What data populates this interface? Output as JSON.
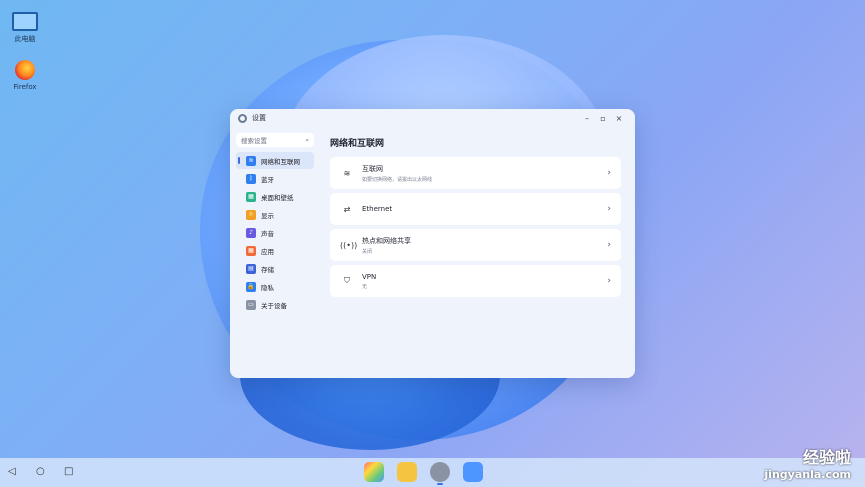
{
  "desktop": {
    "icons": [
      {
        "label": "此电脑",
        "icon": "monitor-icon"
      },
      {
        "label": "Firefox",
        "icon": "firefox-icon"
      }
    ]
  },
  "window": {
    "title": "设置",
    "controls": {
      "minimize": "–",
      "maximize": "▫",
      "close": "×"
    }
  },
  "sidebar": {
    "search_placeholder": "搜索设置",
    "search_icon": "⌕",
    "items": [
      {
        "label": "网络和互联网",
        "icon": "wifi-icon",
        "color": "#2f7ff0",
        "glyph": "≋",
        "active": true
      },
      {
        "label": "蓝牙",
        "icon": "bluetooth-icon",
        "color": "#2f7ff0",
        "glyph": "ᛒ"
      },
      {
        "label": "桌面和壁纸",
        "icon": "wallpaper-icon",
        "color": "#2bb38a",
        "glyph": "▦"
      },
      {
        "label": "显示",
        "icon": "display-icon",
        "color": "#f0a020",
        "glyph": "☼"
      },
      {
        "label": "声音",
        "icon": "sound-icon",
        "color": "#6a5ae0",
        "glyph": "♪"
      },
      {
        "label": "应用",
        "icon": "apps-icon",
        "color": "#f06a3a",
        "glyph": "▦"
      },
      {
        "label": "存储",
        "icon": "storage-icon",
        "color": "#3a64d8",
        "glyph": "▤"
      },
      {
        "label": "隐私",
        "icon": "privacy-icon",
        "color": "#2f7ff0",
        "glyph": "🔒"
      },
      {
        "label": "关于设备",
        "icon": "about-icon",
        "color": "#8a93a3",
        "glyph": "▭"
      }
    ]
  },
  "main": {
    "heading": "网络和互联网",
    "cards": [
      {
        "title": "互联网",
        "subtitle": "如要切换网络，请拔出以太网线",
        "icon": "wifi-icon",
        "glyph": "≋"
      },
      {
        "title": "Ethernet",
        "subtitle": "",
        "icon": "ethernet-icon",
        "glyph": "⇄"
      },
      {
        "title": "热点和网络共享",
        "subtitle": "关闭",
        "icon": "hotspot-icon",
        "glyph": "((•))"
      },
      {
        "title": "VPN",
        "subtitle": "无",
        "icon": "vpn-shield-icon",
        "glyph": "⛉"
      }
    ],
    "chevron": "›"
  },
  "taskbar": {
    "nav": {
      "back": "◁",
      "home": "○",
      "recents": "□"
    }
  },
  "watermark": {
    "line1": "经验啦",
    "line2": "jingyanla.com"
  }
}
